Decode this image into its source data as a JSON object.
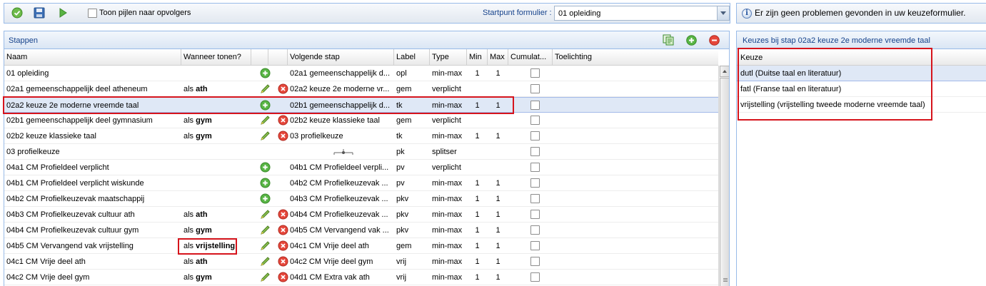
{
  "toolbar": {
    "checkbox_label": "Toon pijlen naar opvolgers",
    "startpunt_label": "Startpunt formulier :",
    "startpunt_value": "01 opleiding"
  },
  "problems_bar": {
    "message": "Er zijn geen problemen gevonden in uw keuzeformulier."
  },
  "stappen": {
    "title": "Stappen",
    "columns": {
      "naam": "Naam",
      "wanneer": "Wanneer tonen?",
      "volgende": "Volgende stap",
      "label": "Label",
      "type": "Type",
      "min": "Min",
      "max": "Max",
      "cumulatief": "Cumulat...",
      "toelichting": "Toelichting"
    },
    "rows": [
      {
        "naam": "01 opleiding",
        "wanneer_prefix": "",
        "wanneer_value": "",
        "edit_icon": false,
        "delete_icon": false,
        "action": "add",
        "volgende": "02a1 gemeenschappelijk d...",
        "label": "opl",
        "type": "min-max",
        "min": "1",
        "max": "1",
        "selected": false
      },
      {
        "naam": "02a1 gemeenschappelijk deel atheneum",
        "wanneer_prefix": "als",
        "wanneer_value": "ath",
        "edit_icon": true,
        "delete_icon": true,
        "action": "",
        "volgende": "02a2 keuze 2e moderne vr...",
        "label": "gem",
        "type": "verplicht",
        "min": "",
        "max": "",
        "selected": false
      },
      {
        "naam": "02a2 keuze 2e moderne vreemde taal",
        "wanneer_prefix": "",
        "wanneer_value": "",
        "edit_icon": false,
        "delete_icon": false,
        "action": "add",
        "volgende": "02b1 gemeenschappelijk d...",
        "label": "tk",
        "type": "min-max",
        "min": "1",
        "max": "1",
        "selected": true
      },
      {
        "naam": "02b1 gemeenschappelijk deel gymnasium",
        "wanneer_prefix": "als",
        "wanneer_value": "gym",
        "edit_icon": true,
        "delete_icon": true,
        "action": "",
        "volgende": "02b2 keuze klassieke taal",
        "label": "gem",
        "type": "verplicht",
        "min": "",
        "max": "",
        "selected": false
      },
      {
        "naam": "02b2 keuze klassieke taal",
        "wanneer_prefix": "als",
        "wanneer_value": "gym",
        "edit_icon": true,
        "delete_icon": true,
        "action": "",
        "volgende": "03 profielkeuze",
        "label": "tk",
        "type": "min-max",
        "min": "1",
        "max": "1",
        "selected": false
      },
      {
        "naam": "03 profielkeuze",
        "wanneer_prefix": "",
        "wanneer_value": "",
        "edit_icon": false,
        "delete_icon": false,
        "action": "split",
        "volgende": "",
        "label": "pk",
        "type": "splitser",
        "min": "",
        "max": "",
        "selected": false
      },
      {
        "naam": "04a1 CM Profieldeel verplicht",
        "wanneer_prefix": "",
        "wanneer_value": "",
        "edit_icon": false,
        "delete_icon": false,
        "action": "add",
        "volgende": "04b1 CM Profieldeel verpli...",
        "label": "pv",
        "type": "verplicht",
        "min": "",
        "max": "",
        "selected": false
      },
      {
        "naam": "04b1 CM Profieldeel verplicht wiskunde",
        "wanneer_prefix": "",
        "wanneer_value": "",
        "edit_icon": false,
        "delete_icon": false,
        "action": "add",
        "volgende": "04b2 CM Profielkeuzevak ...",
        "label": "pv",
        "type": "min-max",
        "min": "1",
        "max": "1",
        "selected": false
      },
      {
        "naam": "04b2 CM Profielkeuzevak maatschappij",
        "wanneer_prefix": "",
        "wanneer_value": "",
        "edit_icon": false,
        "delete_icon": false,
        "action": "add",
        "volgende": "04b3 CM Profielkeuzevak ...",
        "label": "pkv",
        "type": "min-max",
        "min": "1",
        "max": "1",
        "selected": false
      },
      {
        "naam": "04b3 CM Profielkeuzevak cultuur ath",
        "wanneer_prefix": "als",
        "wanneer_value": "ath",
        "edit_icon": true,
        "delete_icon": true,
        "action": "",
        "volgende": "04b4 CM Profielkeuzevak ...",
        "label": "pkv",
        "type": "min-max",
        "min": "1",
        "max": "1",
        "selected": false
      },
      {
        "naam": "04b4 CM Profielkeuzevak cultuur gym",
        "wanneer_prefix": "als",
        "wanneer_value": "gym",
        "edit_icon": true,
        "delete_icon": true,
        "action": "",
        "volgende": "04b5 CM Vervangend vak ...",
        "label": "pkv",
        "type": "min-max",
        "min": "1",
        "max": "1",
        "selected": false
      },
      {
        "naam": "04b5 CM Vervangend vak vrijstelling",
        "wanneer_prefix": "als",
        "wanneer_value": "vrijstelling",
        "edit_icon": true,
        "delete_icon": true,
        "action": "",
        "volgende": "04c1 CM Vrije deel ath",
        "label": "gem",
        "type": "min-max",
        "min": "1",
        "max": "1",
        "selected": false
      },
      {
        "naam": "04c1 CM Vrije deel ath",
        "wanneer_prefix": "als",
        "wanneer_value": "ath",
        "edit_icon": true,
        "delete_icon": true,
        "action": "",
        "volgende": "04c2 CM Vrije deel gym",
        "label": "vrij",
        "type": "min-max",
        "min": "1",
        "max": "1",
        "selected": false
      },
      {
        "naam": "04c2 CM Vrije deel gym",
        "wanneer_prefix": "als",
        "wanneer_value": "gym",
        "edit_icon": true,
        "delete_icon": true,
        "action": "",
        "volgende": "04d1 CM Extra vak ath",
        "label": "vrij",
        "type": "min-max",
        "min": "1",
        "max": "1",
        "selected": false
      }
    ]
  },
  "keuzes": {
    "title": "Keuzes bij stap 02a2 keuze 2e moderne vreemde taal",
    "column": "Keuze",
    "rows": [
      {
        "label": "dutl (Duitse taal en literatuur)",
        "selected": true
      },
      {
        "label": "fatl (Franse taal en literatuur)",
        "selected": false
      },
      {
        "label": "vrijstelling (vrijstelling tweede moderne vreemde taal)",
        "selected": false
      }
    ]
  },
  "colors": {
    "panel_border": "#99bbe8",
    "header_text": "#15428b",
    "selection": "#dfe8f6",
    "annotation_red": "#d6141c",
    "add_green": "#4caf3c",
    "delete_red": "#e23a2e"
  },
  "icons": [
    "check-icon",
    "save-icon",
    "run-icon",
    "info-icon",
    "copy-icon",
    "add-icon",
    "remove-icon",
    "edit-icon",
    "delete-icon",
    "split-icon"
  ]
}
